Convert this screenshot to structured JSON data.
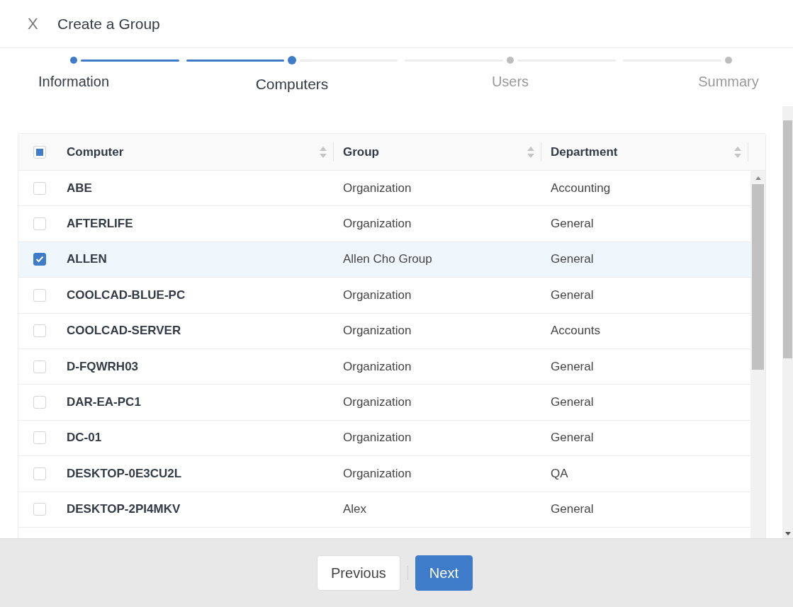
{
  "dialog": {
    "close_icon": "X",
    "title": "Create a Group"
  },
  "steps": [
    {
      "label": "Information",
      "completed": true,
      "selected": false
    },
    {
      "label": "Computers",
      "completed": false,
      "selected": true
    },
    {
      "label": "Users",
      "completed": false,
      "selected": false
    },
    {
      "label": "Summary",
      "completed": false,
      "selected": false
    }
  ],
  "table": {
    "select_all_indeterminate": true,
    "columns": [
      {
        "label": "Computer",
        "sortable": true
      },
      {
        "label": "Group",
        "sortable": true
      },
      {
        "label": "Department",
        "sortable": true
      }
    ],
    "rows": [
      {
        "computer": "ABE",
        "group": "Organization",
        "department": "Accounting",
        "selected": false
      },
      {
        "computer": "AFTERLIFE",
        "group": "Organization",
        "department": "General",
        "selected": false
      },
      {
        "computer": "ALLEN",
        "group": "Allen Cho Group",
        "department": "General",
        "selected": true
      },
      {
        "computer": "COOLCAD-BLUE-PC",
        "group": "Organization",
        "department": "General",
        "selected": false
      },
      {
        "computer": "COOLCAD-SERVER",
        "group": "Organization",
        "department": "Accounts",
        "selected": false
      },
      {
        "computer": "D-FQWRH03",
        "group": "Organization",
        "department": "General",
        "selected": false
      },
      {
        "computer": "DAR-EA-PC1",
        "group": "Organization",
        "department": "General",
        "selected": false
      },
      {
        "computer": "DC-01",
        "group": "Organization",
        "department": "General",
        "selected": false
      },
      {
        "computer": "DESKTOP-0E3CU2L",
        "group": "Organization",
        "department": "QA",
        "selected": false
      },
      {
        "computer": "DESKTOP-2PI4MKV",
        "group": "Alex",
        "department": "General",
        "selected": false
      }
    ]
  },
  "footer": {
    "buttons": [
      {
        "label": "Previous",
        "kind": "secondary"
      },
      {
        "label": "Next",
        "kind": "primary"
      }
    ]
  }
}
